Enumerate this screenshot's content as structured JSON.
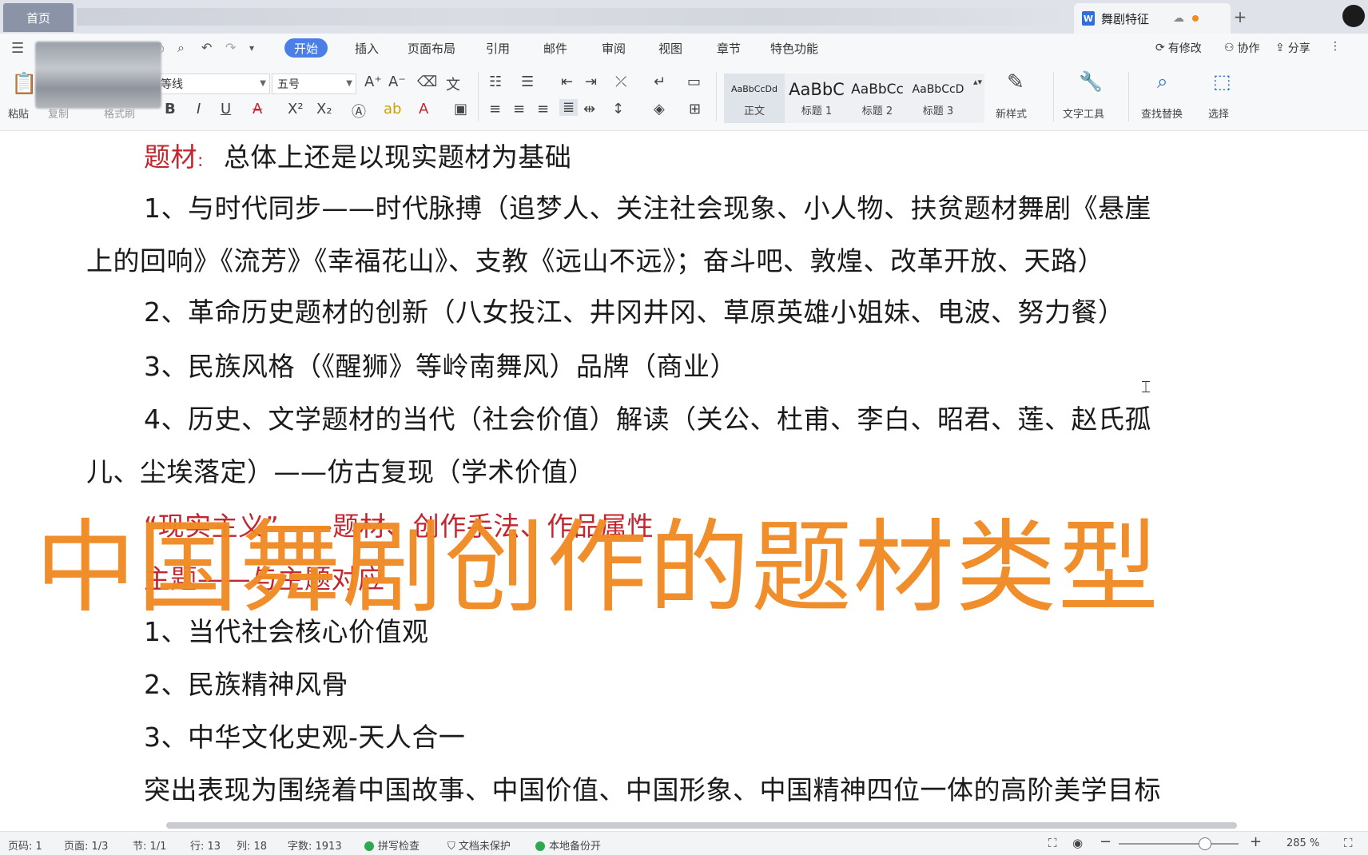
{
  "titlebar": {
    "home_tab": "首页",
    "doc_tab": "舞剧特征",
    "doc_icon": "W",
    "new_tab": "+"
  },
  "menu": {
    "items": [
      "开始",
      "插入",
      "页面布局",
      "引用",
      "邮件",
      "审阅",
      "视图",
      "章节",
      "特色功能"
    ],
    "active": "开始",
    "has_changes": "有修改",
    "collab": "协作",
    "share": "分享"
  },
  "toolbar": {
    "paste": "粘贴",
    "copy": "复制",
    "format_painter": "格式刷",
    "font_name": "等线",
    "font_size": "五号",
    "bold": "B",
    "italic": "I",
    "underline": "U",
    "styles": [
      {
        "preview": "AaBbCcDd",
        "name": "正文"
      },
      {
        "preview": "AaBbC",
        "name": "标题 1"
      },
      {
        "preview": "AaBbCc",
        "name": "标题 2"
      },
      {
        "preview": "AaBbCcD",
        "name": "标题 3"
      }
    ],
    "new_style": "新样式",
    "text_tools": "文字工具",
    "find_replace": "查找替换",
    "select": "选择"
  },
  "document": {
    "l1_label": "题材",
    "l1_colon": ":",
    "l1_text": "总体上还是以现实题材为基础",
    "l2": "1、与时代同步——时代脉搏（追梦人、关注社会现象、小人物、扶贫题材舞剧《悬崖",
    "l3": "上的回响》《流芳》《幸福花山》、支教《远山不远》；奋斗吧、敦煌、改革开放、天路）",
    "l4": "2、革命历史题材的创新（八女投江、井冈井冈、草原英雄小姐妹、电波、努力餐）",
    "l5": "3、民族风格（《醒狮》等岭南舞风）品牌（商业）",
    "l6": "4、历史、文学题材的当代（社会价值）解读（关公、杜甫、李白、昭君、莲、赵氏孤",
    "l7": "儿、尘埃落定）——仿古复现（学术价值）",
    "l8": "“现实主义”——题材、创作手法、作品属性",
    "l9": "主题——与主题对应",
    "l10": "1、当代社会核心价值观",
    "l11": "2、民族精神风骨",
    "l12": "3、中华文化史观-天人合一",
    "l13": "突出表现为围绕着中国故事、中国价值、中国形象、中国精神四位一体的高阶美学目标"
  },
  "overlay": {
    "title": "中国舞剧创作的题材类型",
    "color": "#f08a24"
  },
  "status": {
    "page_code": "页码: 1",
    "page": "页面: 1/3",
    "section": "节: 1/1",
    "row": "行: 13",
    "col": "列: 18",
    "word_count": "字数: 1913",
    "spell_check": "拼写检查",
    "doc_protect": "文档未保护",
    "backup": "本地备份开",
    "zoom": "285 %"
  }
}
